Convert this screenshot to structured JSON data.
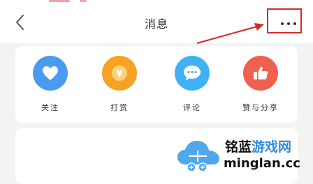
{
  "header": {
    "title": "消息",
    "back_icon": "chevron-left-icon",
    "more_icon": "more-horizontal-icon"
  },
  "annotation": {
    "highlight_color": "#d42a2a"
  },
  "categories": [
    {
      "label": "关注",
      "icon": "heart-icon",
      "color": "#4a9bf0"
    },
    {
      "label": "打赏",
      "icon": "yen-coin-icon",
      "color": "#f7a224"
    },
    {
      "label": "评论",
      "icon": "chat-bubble-icon",
      "color": "#3fb2f5"
    },
    {
      "label": "赞与分享",
      "icon": "thumbs-up-icon",
      "color": "#f0604f"
    }
  ],
  "watermark": {
    "brand_dark": "铭蓝",
    "brand_blue": "游戏网",
    "url": "minglan.cc"
  }
}
